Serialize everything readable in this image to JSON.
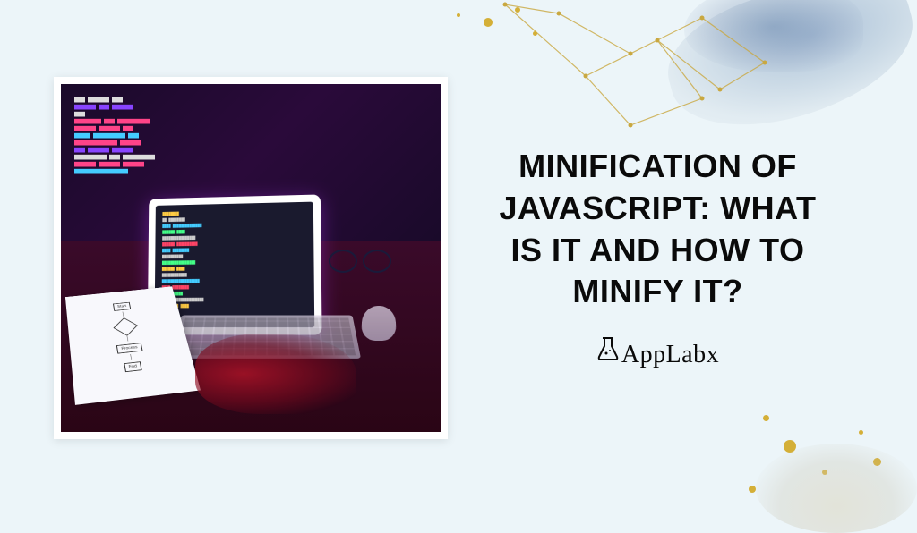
{
  "headline": "Minification of JavaScript: What is it and How to Minify It?",
  "brand": {
    "name": "AppLabx"
  },
  "image": {
    "description": "Developer workspace with tablet showing code, keyboard, mouse, glasses, and flowchart paper under purple/red lighting"
  }
}
